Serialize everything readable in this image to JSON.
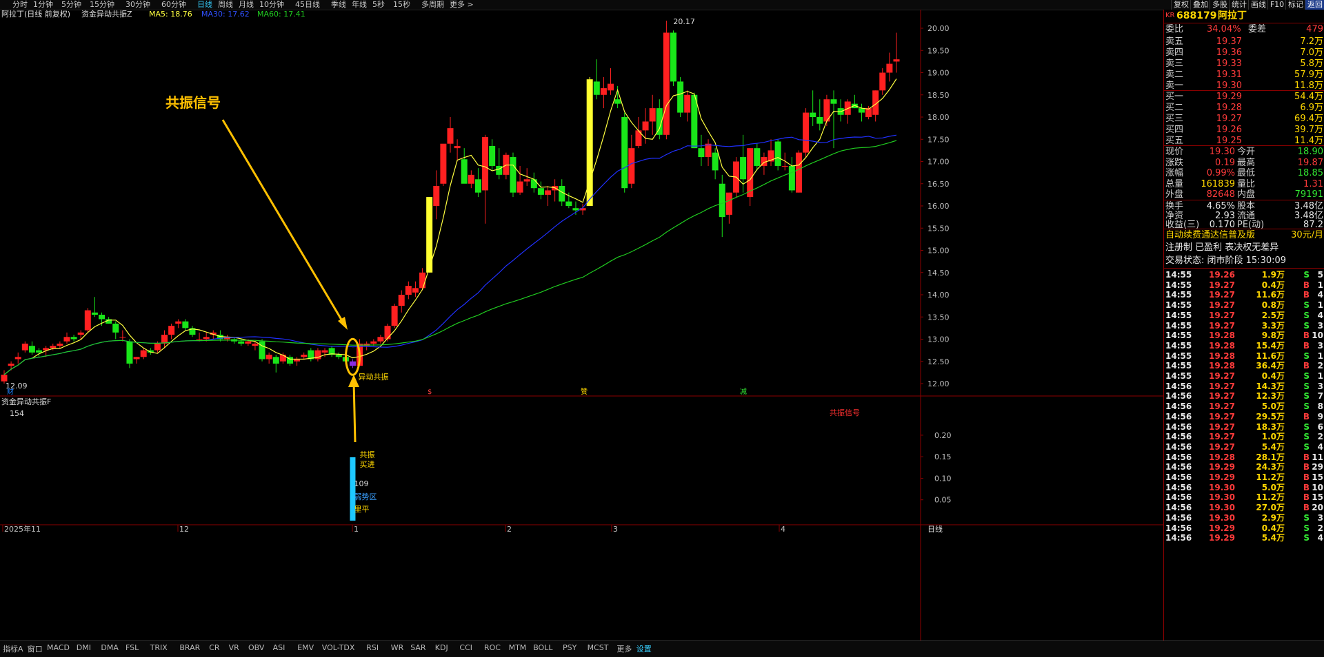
{
  "topbar": {
    "periods": [
      "分时",
      "1分钟",
      "5分钟",
      "15分钟",
      "30分钟",
      "60分钟",
      "日线",
      "周线",
      "月线",
      "10分钟",
      "45日线",
      "季线",
      "年线",
      "5秒",
      "15秒",
      "多周期",
      "更多 >"
    ],
    "active_period": "日线",
    "buttons": [
      "复权",
      "叠加",
      "多股",
      "统计",
      "画线",
      "F10",
      "标记",
      "返回"
    ]
  },
  "chart": {
    "header_name": "阿拉丁(日线 前复权)",
    "indicator_name": "资金异动共振Z",
    "ma5": "MA5: 18.76",
    "ma30": "MA30: 17.62",
    "ma60": "MA60: 17.41",
    "high_label": "20.17",
    "low_label": "12.09",
    "y_ticks": [
      "20.00",
      "19.50",
      "19.00",
      "18.50",
      "18.00",
      "17.50",
      "17.00",
      "16.50",
      "16.00",
      "15.50",
      "15.00",
      "14.50",
      "14.00",
      "13.50",
      "13.00",
      "12.50",
      "12.00"
    ],
    "annotation_title": "共振信号",
    "signal_label": "异动共振",
    "event_markers": [
      "财",
      "$",
      "赞",
      "减"
    ],
    "sub_indicator_name": "资金异动共振F",
    "sub_value": "154",
    "sub_signal_text": "共振信号",
    "sub_y_ticks": [
      "0.20",
      "0.15",
      "0.10",
      "0.05"
    ],
    "sub_labels": [
      "共振",
      "买进",
      "109",
      "弱势区",
      "里平"
    ],
    "x_labels": [
      "2025年11",
      "12",
      "1",
      "2",
      "3",
      "4"
    ],
    "period_label": "日线"
  },
  "colors": {
    "up": "#ff2020",
    "down": "#19e619",
    "ma5": "#ffff40",
    "ma30": "#2030ff",
    "ma60": "#20cc20",
    "signal": "#ffc000"
  },
  "stock": {
    "code": "688179",
    "name": "阿拉丁",
    "prefix": "KR"
  },
  "quote_top": {
    "label": "委比",
    "value": "34.04%",
    "label2": "委差",
    "value2": "479"
  },
  "asks": [
    {
      "label": "卖五",
      "price": "19.37",
      "vol": "7.2万"
    },
    {
      "label": "卖四",
      "price": "19.36",
      "vol": "7.0万"
    },
    {
      "label": "卖三",
      "price": "19.33",
      "vol": "5.8万"
    },
    {
      "label": "卖二",
      "price": "19.31",
      "vol": "57.9万"
    },
    {
      "label": "卖一",
      "price": "19.30",
      "vol": "11.8万"
    }
  ],
  "bids": [
    {
      "label": "买一",
      "price": "19.29",
      "vol": "54.4万"
    },
    {
      "label": "买二",
      "price": "19.28",
      "vol": "6.9万"
    },
    {
      "label": "买三",
      "price": "19.27",
      "vol": "69.4万"
    },
    {
      "label": "买四",
      "price": "19.26",
      "vol": "39.7万"
    },
    {
      "label": "买五",
      "price": "19.25",
      "vol": "11.4万"
    }
  ],
  "stats": [
    {
      "l1": "现价",
      "v1": "19.30",
      "l2": "今开",
      "v2": "18.90"
    },
    {
      "l1": "涨跌",
      "v1": "0.19",
      "l2": "最高",
      "v2": "19.87"
    },
    {
      "l1": "涨幅",
      "v1": "0.99%",
      "l2": "最低",
      "v2": "18.85"
    },
    {
      "l1": "总量",
      "v1": "161839",
      "l2": "量比",
      "v2": "1.31"
    },
    {
      "l1": "外盘",
      "v1": "82648",
      "l2": "内盘",
      "v2": "79191"
    }
  ],
  "stats2": [
    {
      "l1": "换手",
      "v1": "4.65%",
      "l2": "股本",
      "v2": "3.48亿"
    },
    {
      "l1": "净资",
      "v1": "2.93",
      "l2": "流通",
      "v2": "3.48亿"
    },
    {
      "l1": "收益(三)",
      "v1": "0.170",
      "l2": "PE(动)",
      "v2": "87.2"
    }
  ],
  "promo": {
    "line1": "自动续费通达信普及版",
    "price": "30元/月",
    "line2": "注册制 已盈利 表决权无差异",
    "line3": "交易状态: 闭市阶段 15:30:09"
  },
  "ticks": [
    {
      "t": "14:55",
      "p": "19.26",
      "v": "1.9万",
      "bs": "S",
      "n": "5"
    },
    {
      "t": "14:55",
      "p": "19.27",
      "v": "0.4万",
      "bs": "B",
      "n": "1"
    },
    {
      "t": "14:55",
      "p": "19.27",
      "v": "11.6万",
      "bs": "B",
      "n": "4"
    },
    {
      "t": "14:55",
      "p": "19.27",
      "v": "0.8万",
      "bs": "S",
      "n": "1"
    },
    {
      "t": "14:55",
      "p": "19.27",
      "v": "2.5万",
      "bs": "S",
      "n": "4"
    },
    {
      "t": "14:55",
      "p": "19.27",
      "v": "3.3万",
      "bs": "S",
      "n": "3"
    },
    {
      "t": "14:55",
      "p": "19.28",
      "v": "9.8万",
      "bs": "B",
      "n": "10"
    },
    {
      "t": "14:55",
      "p": "19.28",
      "v": "15.4万",
      "bs": "B",
      "n": "3"
    },
    {
      "t": "14:55",
      "p": "19.28",
      "v": "11.6万",
      "bs": "S",
      "n": "1"
    },
    {
      "t": "14:55",
      "p": "19.28",
      "v": "36.4万",
      "bs": "B",
      "n": "2"
    },
    {
      "t": "14:55",
      "p": "19.27",
      "v": "0.4万",
      "bs": "S",
      "n": "1"
    },
    {
      "t": "14:56",
      "p": "19.27",
      "v": "14.3万",
      "bs": "S",
      "n": "3"
    },
    {
      "t": "14:56",
      "p": "19.27",
      "v": "12.3万",
      "bs": "S",
      "n": "7"
    },
    {
      "t": "14:56",
      "p": "19.27",
      "v": "5.0万",
      "bs": "S",
      "n": "8"
    },
    {
      "t": "14:56",
      "p": "19.27",
      "v": "29.5万",
      "bs": "B",
      "n": "9"
    },
    {
      "t": "14:56",
      "p": "19.27",
      "v": "18.3万",
      "bs": "S",
      "n": "6"
    },
    {
      "t": "14:56",
      "p": "19.27",
      "v": "1.0万",
      "bs": "S",
      "n": "2"
    },
    {
      "t": "14:56",
      "p": "19.27",
      "v": "5.4万",
      "bs": "S",
      "n": "4"
    },
    {
      "t": "14:56",
      "p": "19.28",
      "v": "28.1万",
      "bs": "B",
      "n": "11"
    },
    {
      "t": "14:56",
      "p": "19.29",
      "v": "24.3万",
      "bs": "B",
      "n": "29"
    },
    {
      "t": "14:56",
      "p": "19.29",
      "v": "11.2万",
      "bs": "B",
      "n": "15"
    },
    {
      "t": "14:56",
      "p": "19.30",
      "v": "5.0万",
      "bs": "B",
      "n": "10"
    },
    {
      "t": "14:56",
      "p": "19.30",
      "v": "11.2万",
      "bs": "B",
      "n": "15"
    },
    {
      "t": "14:56",
      "p": "19.30",
      "v": "27.0万",
      "bs": "B",
      "n": "20"
    },
    {
      "t": "14:56",
      "p": "19.30",
      "v": "2.9万",
      "bs": "S",
      "n": "3"
    },
    {
      "t": "14:56",
      "p": "19.29",
      "v": "0.4万",
      "bs": "S",
      "n": "2"
    },
    {
      "t": "14:56",
      "p": "19.29",
      "v": "5.4万",
      "bs": "S",
      "n": "4"
    }
  ],
  "bottom_tabs": [
    "指标A",
    "窗口",
    "MACD",
    "DMI",
    "DMA",
    "FSL",
    "TRIX",
    "BRAR",
    "CR",
    "VR",
    "OBV",
    "ASI",
    "EMV",
    "VOL-TDX",
    "RSI",
    "WR",
    "SAR",
    "KDJ",
    "CCI",
    "ROC",
    "MTM",
    "BOLL",
    "PSY",
    "MCST",
    "更多",
    "设置"
  ]
}
